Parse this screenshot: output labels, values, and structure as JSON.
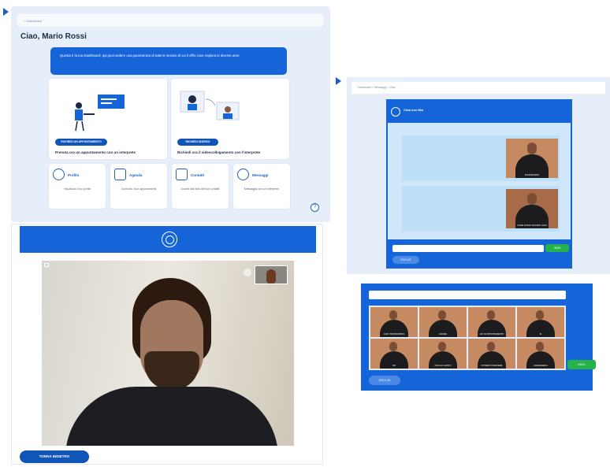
{
  "dashboard": {
    "breadcrumb": "Dashboard",
    "greeting": "Ciao, Mario Rossi",
    "intro": "Questa è la tua Dashboard, qui puoi vedere una panoramica di tutte le sezioni di cui ti offre Lisa: esplora le diverse aree.",
    "booking": {
      "button_label": "RICHIEDI UN APPUNTAMENTO",
      "caption": "Prenota ora un appuntamento con un interprete"
    },
    "videocall": {
      "button_label": "RICHIEDI ADESSO",
      "caption": "Richiedi ora il videocollegamento con l'interprete"
    },
    "cards": [
      {
        "title": "Profilo",
        "desc": "Visualizza il tuo profilo"
      },
      {
        "title": "Agenda",
        "desc": "Controlla i tuoi appuntamenti"
      },
      {
        "title": "Contatti",
        "desc": "Accedi alla lista dei tuoi contatti"
      },
      {
        "title": "Messaggi",
        "desc": "Messaggia con un interprete"
      }
    ],
    "help_label": "?"
  },
  "video": {
    "back_label": "TORNA INDIETRO"
  },
  "chat": {
    "breadcrumb": "Dashboard  >  Messaggi  >  Chat",
    "title": "Chat con Mia",
    "messages": [
      {
        "caption": "BUONGIORNO"
      },
      {
        "caption": "COME POSSO AIUTARTI OGGI"
      }
    ],
    "send_label": "INVIA",
    "exit_label": "ESCI LIS"
  },
  "signs": {
    "cells": [
      "CIAO / BUONGIORNO",
      "GRAZIE",
      "HO UN APPUNTAMENTO",
      "SI",
      "NO",
      "NON HO CAPITO",
      "POTRESTI RIPETERE",
      "ARRIVEDERCI"
    ],
    "send_label": "INVIA",
    "exit_label": "ESCI LIS"
  }
}
